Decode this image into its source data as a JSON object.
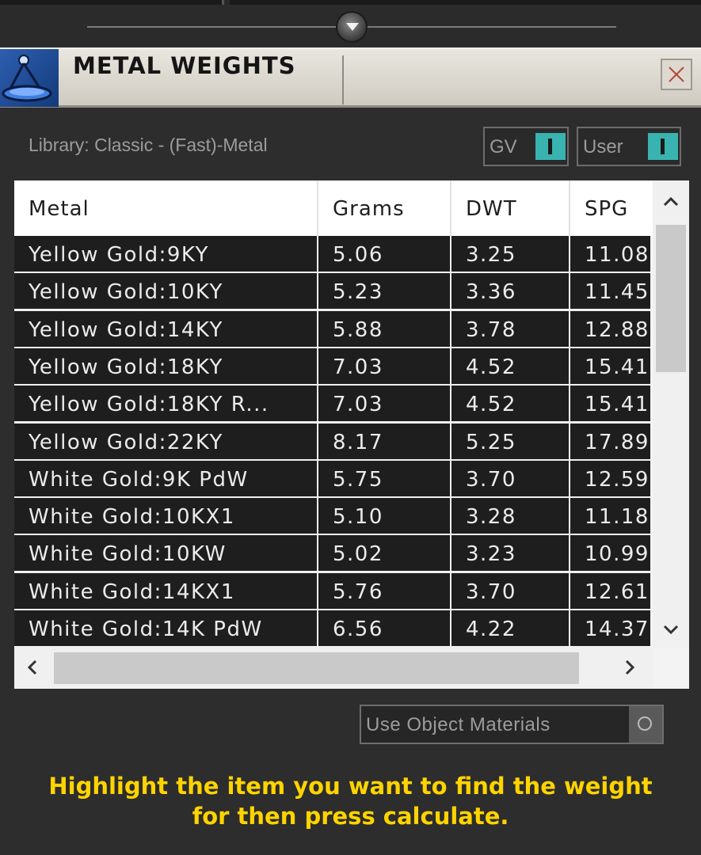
{
  "header": {
    "title": "METAL WEIGHTS",
    "logo_icon": "scale-icon",
    "close_icon": "close-icon"
  },
  "library": {
    "label": "Library: Classic - (Fast)-Metal"
  },
  "toggles": [
    {
      "label": "GV",
      "state": "on"
    },
    {
      "label": "User",
      "state": "on"
    }
  ],
  "table": {
    "columns": [
      "Metal",
      "Grams",
      "DWT",
      "SPG"
    ],
    "rows": [
      [
        "Yellow Gold:9KY",
        "5.06",
        "3.25",
        "11.08"
      ],
      [
        "Yellow Gold:10KY",
        "5.23",
        "3.36",
        "11.45"
      ],
      [
        "Yellow Gold:14KY",
        "5.88",
        "3.78",
        "12.88"
      ],
      [
        "Yellow Gold:18KY",
        "7.03",
        "4.52",
        "15.41"
      ],
      [
        "Yellow Gold:18KY R...",
        "7.03",
        "4.52",
        "15.41"
      ],
      [
        "Yellow Gold:22KY",
        "8.17",
        "5.25",
        "17.89"
      ],
      [
        "White Gold:9K PdW",
        "5.75",
        "3.70",
        "12.59"
      ],
      [
        "White Gold:10KX1",
        "5.10",
        "3.28",
        "11.18"
      ],
      [
        "White Gold:10KW",
        "5.02",
        "3.23",
        "10.99"
      ],
      [
        "White Gold:14KX1",
        "5.76",
        "3.70",
        "12.61"
      ],
      [
        "White Gold:14K PdW",
        "6.56",
        "4.22",
        "14.37"
      ]
    ]
  },
  "use_object_materials": {
    "label": "Use Object Materials"
  },
  "hint": {
    "line1": "Highlight the item you want to find the weight",
    "line2": "for then press calculate."
  },
  "colors": {
    "background": "#2d2d2d",
    "hint_text": "#ffd400",
    "toggle_on": "#39b3b0",
    "row_bg": "#1e1e1e"
  }
}
